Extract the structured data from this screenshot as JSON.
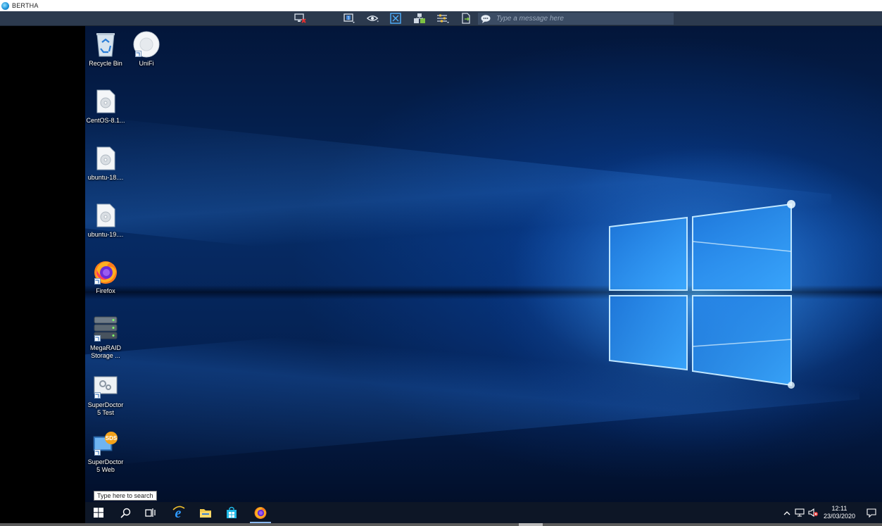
{
  "window": {
    "title": "BERTHA"
  },
  "toolbar": {
    "icons": [
      "disconnect-icon",
      "monitor-select-icon",
      "view-only-icon",
      "fit-screen-icon",
      "remote-control-icon",
      "settings-icon",
      "file-transfer-icon",
      "chat-icon"
    ],
    "message_placeholder": "Type a message here"
  },
  "desktop": {
    "icons": [
      {
        "label": "Recycle Bin",
        "icon": "recycle-bin-icon"
      },
      {
        "label": "UniFi",
        "icon": "unifi-icon"
      },
      {
        "label": "CentOS-8.1...",
        "icon": "disc-image-icon"
      },
      {
        "label": "ubuntu-18....",
        "icon": "disc-image-icon"
      },
      {
        "label": "ubuntu-19....",
        "icon": "disc-image-icon"
      },
      {
        "label": "Firefox",
        "icon": "firefox-icon"
      },
      {
        "label": "MegaRAID\nStorage ...",
        "icon": "megaraid-icon"
      },
      {
        "label": "SuperDoctor\n5 Test",
        "icon": "superdoctor-test-icon"
      },
      {
        "label": "SuperDoctor\n5 Web",
        "icon": "superdoctor-web-icon"
      }
    ],
    "search_tooltip": "Type here to search"
  },
  "taskbar": {
    "items": [
      "start-icon",
      "search-icon",
      "task-view-icon",
      "internet-explorer-icon",
      "file-explorer-icon",
      "store-icon",
      "firefox-icon"
    ],
    "active_item": "firefox-icon",
    "tray": {
      "time": "12:11",
      "date": "23/03/2020"
    }
  },
  "colors": {
    "toolbar_bg": "#2c3a4e",
    "taskbar_bg": "#0d1626",
    "accent": "#1a8fd6"
  }
}
